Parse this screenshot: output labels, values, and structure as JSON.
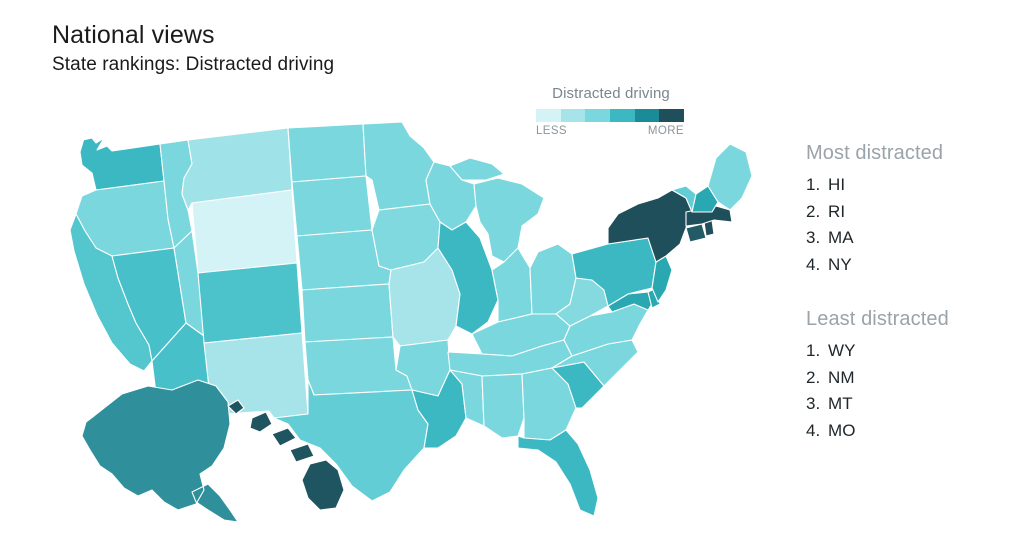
{
  "header": {
    "title": "National views",
    "subtitle": "State rankings: Distracted driving"
  },
  "legend": {
    "title": "Distracted driving",
    "low_label": "LESS",
    "high_label": "MORE",
    "colors": [
      "#d4f3f7",
      "#a6e4ea",
      "#7ad7dd",
      "#3bb8c1",
      "#1b8c97",
      "#1f4f5a"
    ]
  },
  "rankings": {
    "most": {
      "heading": "Most distracted",
      "items": [
        {
          "rank": "1.",
          "state": "HI"
        },
        {
          "rank": "2.",
          "state": "RI"
        },
        {
          "rank": "3.",
          "state": "MA"
        },
        {
          "rank": "4.",
          "state": "NY"
        }
      ]
    },
    "least": {
      "heading": "Least distracted",
      "items": [
        {
          "rank": "1.",
          "state": "WY"
        },
        {
          "rank": "2.",
          "state": "NM"
        },
        {
          "rank": "3.",
          "state": "MT"
        },
        {
          "rank": "4.",
          "state": "MO"
        }
      ]
    }
  },
  "chart_data": {
    "type": "heatmap",
    "title": "National views",
    "subtitle": "State rankings: Distracted driving",
    "legend_title": "Distracted driving",
    "legend_low": "LESS",
    "legend_high": "MORE",
    "color_scale": [
      "#d4f3f7",
      "#a6e4ea",
      "#7ad7dd",
      "#3bb8c1",
      "#1b8c97",
      "#1f4f5a"
    ],
    "bins": 6,
    "value_key": "bin_index_0_is_least_distracted",
    "states": [
      {
        "code": "WA",
        "bin": 4,
        "color": "#3bb8c1"
      },
      {
        "code": "OR",
        "bin": 2,
        "color": "#7ad7dd"
      },
      {
        "code": "CA",
        "bin": 3,
        "color": "#53c6ce"
      },
      {
        "code": "NV",
        "bin": 3,
        "color": "#48c0c9"
      },
      {
        "code": "ID",
        "bin": 2,
        "color": "#7ad7dd"
      },
      {
        "code": "MT",
        "bin": 1,
        "color": "#9fe2e8"
      },
      {
        "code": "WY",
        "bin": 0,
        "color": "#d4f3f7"
      },
      {
        "code": "UT",
        "bin": 2,
        "color": "#7ad7dd"
      },
      {
        "code": "AZ",
        "bin": 3,
        "color": "#48c0c9"
      },
      {
        "code": "CO",
        "bin": 3,
        "color": "#4cc2cb"
      },
      {
        "code": "NM",
        "bin": 1,
        "color": "#a6e4ea"
      },
      {
        "code": "ND",
        "bin": 2,
        "color": "#7ad7dd"
      },
      {
        "code": "SD",
        "bin": 2,
        "color": "#7ad7dd"
      },
      {
        "code": "NE",
        "bin": 2,
        "color": "#7ad7dd"
      },
      {
        "code": "KS",
        "bin": 2,
        "color": "#7ad7dd"
      },
      {
        "code": "OK",
        "bin": 2,
        "color": "#7ad7dd"
      },
      {
        "code": "TX",
        "bin": 3,
        "color": "#62cdd4"
      },
      {
        "code": "MN",
        "bin": 2,
        "color": "#7ad7dd"
      },
      {
        "code": "IA",
        "bin": 2,
        "color": "#80d9df"
      },
      {
        "code": "MO",
        "bin": 1,
        "color": "#a6e4ea"
      },
      {
        "code": "AR",
        "bin": 2,
        "color": "#7ad7dd"
      },
      {
        "code": "LA",
        "bin": 4,
        "color": "#3bb8c1"
      },
      {
        "code": "WI",
        "bin": 2,
        "color": "#7ad7dd"
      },
      {
        "code": "IL",
        "bin": 4,
        "color": "#3bb8c1"
      },
      {
        "code": "MI",
        "bin": 2,
        "color": "#7ad7dd"
      },
      {
        "code": "IN",
        "bin": 2,
        "color": "#7ad7dd"
      },
      {
        "code": "OH",
        "bin": 2,
        "color": "#7ad7dd"
      },
      {
        "code": "KY",
        "bin": 2,
        "color": "#7ad7dd"
      },
      {
        "code": "TN",
        "bin": 2,
        "color": "#7ad7dd"
      },
      {
        "code": "MS",
        "bin": 2,
        "color": "#7ad7dd"
      },
      {
        "code": "AL",
        "bin": 2,
        "color": "#7ad7dd"
      },
      {
        "code": "GA",
        "bin": 2,
        "color": "#7ad7dd"
      },
      {
        "code": "FL",
        "bin": 4,
        "color": "#3bb8c1"
      },
      {
        "code": "SC",
        "bin": 4,
        "color": "#3bb8c1"
      },
      {
        "code": "NC",
        "bin": 2,
        "color": "#7ad7dd"
      },
      {
        "code": "VA",
        "bin": 2,
        "color": "#7ad7dd"
      },
      {
        "code": "WV",
        "bin": 2,
        "color": "#84dadf"
      },
      {
        "code": "MD",
        "bin": 4,
        "color": "#2aa8b2"
      },
      {
        "code": "DE",
        "bin": 4,
        "color": "#2aa8b2"
      },
      {
        "code": "PA",
        "bin": 3,
        "color": "#3bb8c1"
      },
      {
        "code": "NJ",
        "bin": 4,
        "color": "#2aa8b2"
      },
      {
        "code": "NY",
        "bin": 5,
        "color": "#1f4f5a"
      },
      {
        "code": "CT",
        "bin": 5,
        "color": "#225b66"
      },
      {
        "code": "RI",
        "bin": 5,
        "color": "#1f4f5a"
      },
      {
        "code": "MA",
        "bin": 5,
        "color": "#1f4f5a"
      },
      {
        "code": "VT",
        "bin": 3,
        "color": "#62cdd4"
      },
      {
        "code": "NH",
        "bin": 4,
        "color": "#2aa8b2"
      },
      {
        "code": "ME",
        "bin": 2,
        "color": "#7ad7dd"
      },
      {
        "code": "AK",
        "bin": 4,
        "color": "#2f8f9b"
      },
      {
        "code": "HI",
        "bin": 5,
        "color": "#1f5560"
      }
    ]
  }
}
